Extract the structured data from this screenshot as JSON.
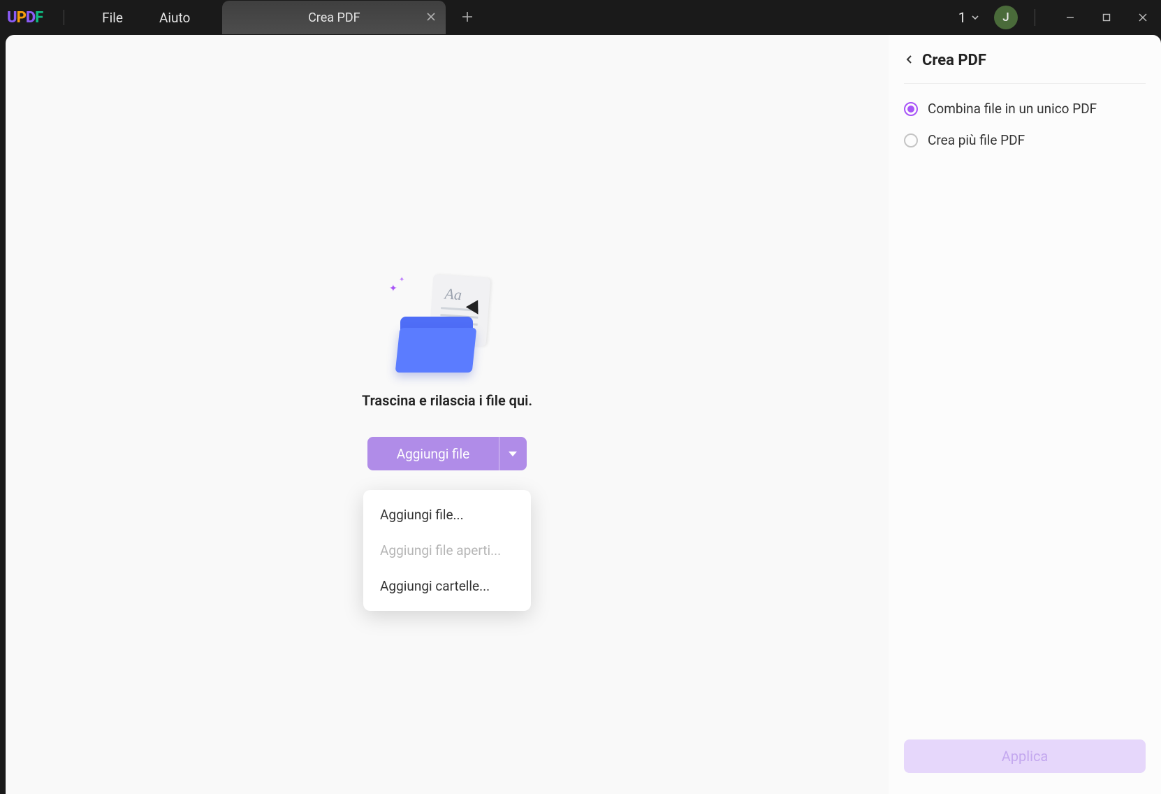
{
  "titlebar": {
    "logo_text": "UPDF",
    "menu": {
      "file": "File",
      "help": "Aiuto"
    },
    "tab": {
      "label": "Crea PDF"
    },
    "tabcount": "1",
    "avatar_initial": "J"
  },
  "main": {
    "drop_message": "Trascina e rilascia i file qui.",
    "add_button": "Aggiungi file",
    "dropdown": {
      "add_file": "Aggiungi file...",
      "add_open_files": "Aggiungi file aperti...",
      "add_folders": "Aggiungi cartelle..."
    }
  },
  "panel": {
    "title": "Crea PDF",
    "option_combine": "Combina file in un unico PDF",
    "option_multiple": "Crea più file PDF",
    "apply": "Applica"
  }
}
